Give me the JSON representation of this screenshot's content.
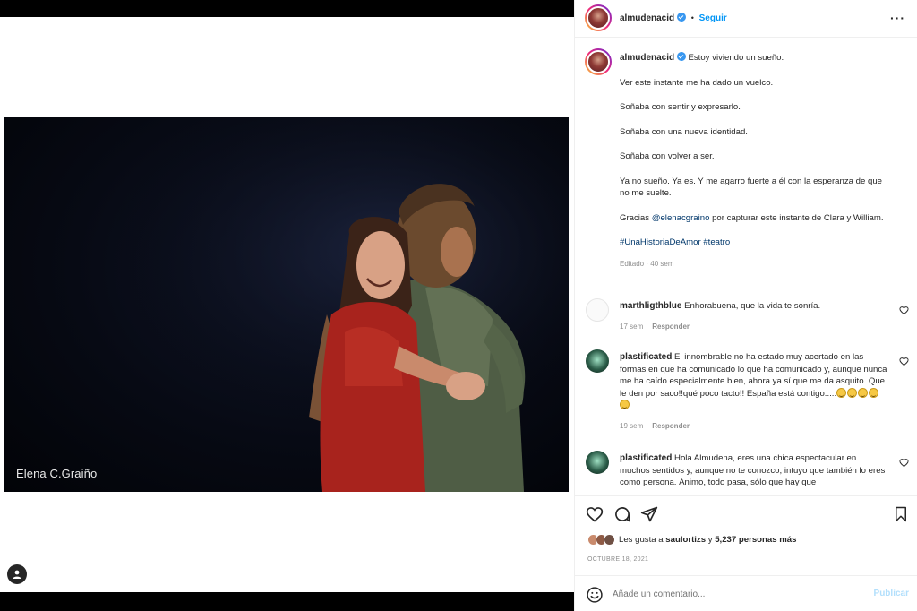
{
  "photo": {
    "watermark": "Elena C.Graiño"
  },
  "header": {
    "username": "almudenacid",
    "separator": "•",
    "follow_label": "Seguir",
    "more_icon": "ellipsis-icon"
  },
  "caption": {
    "username": "almudenacid",
    "first_line": "Estoy viviendo un sueño.",
    "lines": [
      "Ver este instante me ha dado un vuelco.",
      "Soñaba con sentir y expresarlo.",
      "Soñaba con una nueva identidad.",
      "Soñaba con volver a ser.",
      "Ya no sueño. Ya es. Y me agarro fuerte a él con la esperanza de que no me suelte."
    ],
    "thanks_prefix": "Gracias ",
    "thanks_mention": "@elenacgraino",
    "thanks_suffix": " por capturar este instante de Clara y William.",
    "hashtag1": "#UnaHistoriaDeAmor",
    "hashtag2": "#teatro",
    "edited": "Editado · 40 sem"
  },
  "comments": [
    {
      "username": "marthligthblue",
      "text": "Enhorabuena, que la vida te sonría.",
      "time": "17 sem",
      "reply": "Responder"
    },
    {
      "username": "plastificated",
      "text": "El innombrable no ha estado muy acertado en las formas en que ha comunicado lo que ha comunicado y, aunque nunca me ha caído especialmente bien, ahora ya sí que me da asquito. Que le den por saco!!qué poco tacto!! España está contigo.....",
      "time": "19 sem",
      "reply": "Responder"
    },
    {
      "username": "plastificated",
      "text": "Hola Almudena, eres una chica espectacular en muchos sentidos y, aunque no te conozco, intuyo que también lo eres como persona. Ánimo, todo pasa, sólo que hay que",
      "time": "",
      "reply": ""
    }
  ],
  "likes": {
    "prefix": "Les gusta a ",
    "user": "saulortizs",
    "middle": " y ",
    "count": "5,237 personas más"
  },
  "date": "OCTUBRE 18, 2021",
  "add_comment": {
    "placeholder": "Añade un comentario...",
    "publish_label": "Publicar"
  },
  "colors": {
    "link": "#00376b",
    "follow": "#0095f6",
    "verified": "#3897f0",
    "publish_disabled": "#b2dffc"
  }
}
